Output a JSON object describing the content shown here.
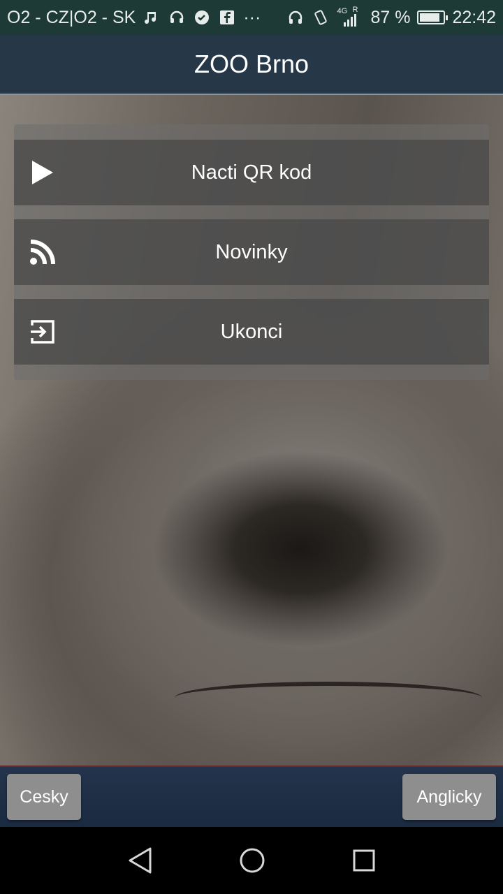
{
  "status_bar": {
    "carrier": "O2 - CZ|O2 - SK",
    "left_icons": [
      "music-note-icon",
      "headset-icon",
      "check-badge-icon",
      "facebook-icon",
      "more-dots-icon"
    ],
    "more_label": "···",
    "right_icons": [
      "headphones-icon",
      "vibrate-icon",
      "signal-4g-icon",
      "battery-icon"
    ],
    "network_label": "4G",
    "roaming_label": "R",
    "battery_percent_label": "87 %",
    "battery_level": 0.87,
    "time": "22:42"
  },
  "header": {
    "title": "ZOO Brno"
  },
  "menu": {
    "items": [
      {
        "label": "Nacti QR kod",
        "icon": "play-icon"
      },
      {
        "label": "Novinky",
        "icon": "rss-feed-icon"
      },
      {
        "label": "Ukonci",
        "icon": "exit-icon"
      }
    ]
  },
  "footer": {
    "left_button": "Cesky",
    "right_button": "Anglicky"
  },
  "nav": {
    "icons": [
      "back-icon",
      "home-icon",
      "recents-icon"
    ]
  },
  "colors": {
    "status_bar": "#1e3a36",
    "title_bar": "#263747",
    "bottom_bar": "#1a2a40",
    "button": "#8e8e8e"
  }
}
